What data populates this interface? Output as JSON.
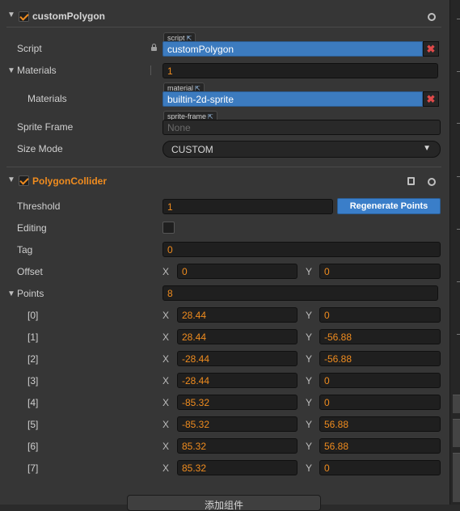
{
  "custom_polygon": {
    "title": "customPolygon",
    "enabled": true,
    "script": {
      "label": "Script",
      "type_tag": "script",
      "value": "customPolygon"
    },
    "materials_group": {
      "label": "Materials",
      "count": "1"
    },
    "material_item": {
      "label": "Materials",
      "type_tag": "material",
      "value": "builtin-2d-sprite"
    },
    "sprite_frame": {
      "label": "Sprite Frame",
      "type_tag": "sprite-frame",
      "value": "None"
    },
    "size_mode": {
      "label": "Size Mode",
      "value": "CUSTOM"
    }
  },
  "polygon_collider": {
    "title": "PolygonCollider",
    "enabled": true,
    "threshold": {
      "label": "Threshold",
      "value": "1"
    },
    "regenerate_button": "Regenerate Points",
    "editing": {
      "label": "Editing",
      "checked": false
    },
    "tag": {
      "label": "Tag",
      "value": "0"
    },
    "offset": {
      "label": "Offset",
      "x_label": "X",
      "x": "0",
      "y_label": "Y",
      "y": "0"
    },
    "points": {
      "label": "Points",
      "count": "8",
      "items": [
        {
          "label": "[0]",
          "x": "28.44",
          "y": "0"
        },
        {
          "label": "[1]",
          "x": "28.44",
          "y": "-56.88"
        },
        {
          "label": "[2]",
          "x": "-28.44",
          "y": "-56.88"
        },
        {
          "label": "[3]",
          "x": "-28.44",
          "y": "0"
        },
        {
          "label": "[4]",
          "x": "-85.32",
          "y": "0"
        },
        {
          "label": "[5]",
          "x": "-85.32",
          "y": "56.88"
        },
        {
          "label": "[6]",
          "x": "85.32",
          "y": "56.88"
        },
        {
          "label": "[7]",
          "x": "85.32",
          "y": "0"
        }
      ]
    }
  },
  "add_component_button": "添加组件",
  "colors": {
    "accent": "#f08c1f",
    "asset_field": "#3c7bbf",
    "remove": "#e04a4a",
    "panel": "#363636"
  }
}
